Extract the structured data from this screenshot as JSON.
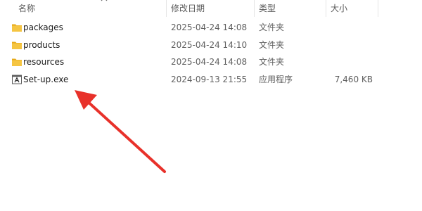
{
  "columns": {
    "name": "名称",
    "date": "修改日期",
    "type": "类型",
    "size": "大小"
  },
  "sort_icon": "chevron-up-icon",
  "files": [
    {
      "name": "packages",
      "date": "2025-04-24 14:08",
      "type": "文件夹",
      "size": "",
      "icon": "folder-icon"
    },
    {
      "name": "products",
      "date": "2025-04-24 14:10",
      "type": "文件夹",
      "size": "",
      "icon": "folder-icon"
    },
    {
      "name": "resources",
      "date": "2025-04-24 14:08",
      "type": "文件夹",
      "size": "",
      "icon": "folder-icon"
    },
    {
      "name": "Set-up.exe",
      "date": "2024-09-13 21:55",
      "type": "应用程序",
      "size": "7,460 KB",
      "icon": "application-icon"
    }
  ],
  "annotation": {
    "arrow_color": "#e8312a",
    "icon": "red-arrow-annotation"
  },
  "colors": {
    "folder": "#f5c542",
    "folder_tab": "#e6a817"
  }
}
